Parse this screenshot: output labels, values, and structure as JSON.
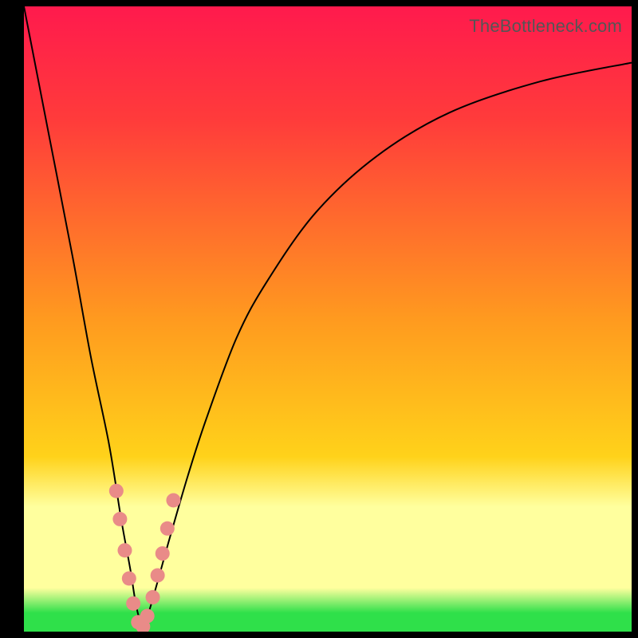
{
  "watermark": {
    "text": "TheBottleneck.com"
  },
  "gradient": {
    "top": "#ff1a4d",
    "upper": "#ff3b3b",
    "mid1": "#ff9a1f",
    "mid2": "#ffd21a",
    "pale": "#ffff9e",
    "green": "#2fe04a"
  },
  "chart_data": {
    "type": "line",
    "title": "",
    "xlabel": "",
    "ylabel": "",
    "xlim": [
      0,
      100
    ],
    "ylim": [
      0,
      100
    ],
    "series": [
      {
        "name": "bottleneck-curve",
        "x": [
          0,
          4,
          8,
          11,
          14,
          16,
          17.5,
          18.5,
          19.5,
          20.5,
          22,
          24,
          27,
          30,
          35,
          40,
          48,
          58,
          70,
          85,
          100
        ],
        "values": [
          100,
          80,
          60,
          44,
          30,
          18,
          10,
          4,
          1,
          3,
          8,
          15,
          25,
          34,
          47,
          56,
          67,
          76,
          83,
          88,
          91
        ]
      }
    ],
    "markers": {
      "name": "highlight-dots",
      "color": "#e98b88",
      "radius_px": 9,
      "points_xy": [
        [
          15.2,
          22.5
        ],
        [
          15.8,
          18.0
        ],
        [
          16.6,
          13.0
        ],
        [
          17.3,
          8.5
        ],
        [
          18.0,
          4.5
        ],
        [
          18.8,
          1.5
        ],
        [
          19.6,
          0.8
        ],
        [
          20.3,
          2.5
        ],
        [
          21.2,
          5.5
        ],
        [
          22.0,
          9.0
        ],
        [
          22.8,
          12.5
        ],
        [
          23.6,
          16.5
        ],
        [
          24.6,
          21.0
        ]
      ]
    }
  }
}
